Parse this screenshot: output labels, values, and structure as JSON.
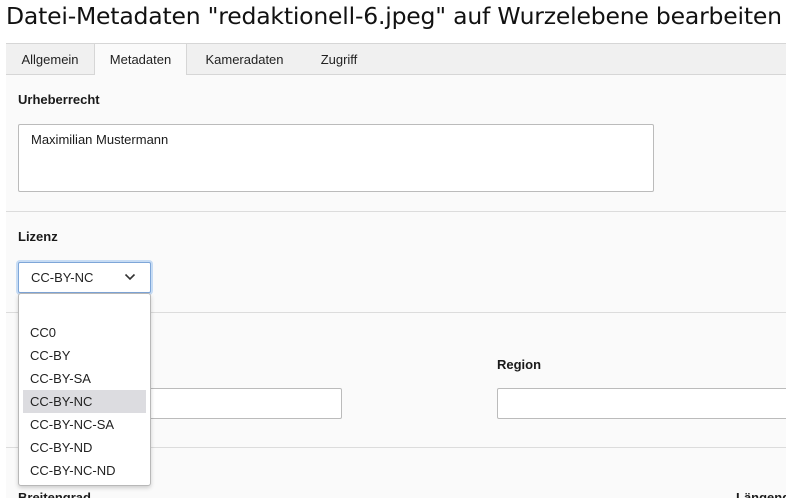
{
  "page": {
    "title": "Datei-Metadaten \"redaktionell-6.jpeg\" auf Wurzelebene bearbeiten"
  },
  "tabs": [
    {
      "label": "Allgemein",
      "active": false
    },
    {
      "label": "Metadaten",
      "active": true
    },
    {
      "label": "Kameradaten",
      "active": false
    },
    {
      "label": "Zugriff",
      "active": false
    }
  ],
  "fields": {
    "copyright": {
      "label": "Urheberrecht",
      "value": "Maximilian Mustermann"
    },
    "license": {
      "label": "Lizenz",
      "value": "CC-BY-NC"
    },
    "region": {
      "label": "Region",
      "value": ""
    },
    "latitude": {
      "label": "Breitengrad"
    },
    "longitude": {
      "label": "Längengrad"
    }
  },
  "license_dropdown": {
    "options": [
      "",
      "CC0",
      "CC-BY",
      "CC-BY-SA",
      "CC-BY-NC",
      "CC-BY-NC-SA",
      "CC-BY-ND",
      "CC-BY-NC-ND"
    ],
    "selected": "CC-BY-NC"
  },
  "colors": {
    "focus": "#7ea6d8",
    "tabbar": "#f0f0f0",
    "selected_option": "#dcdce0"
  }
}
